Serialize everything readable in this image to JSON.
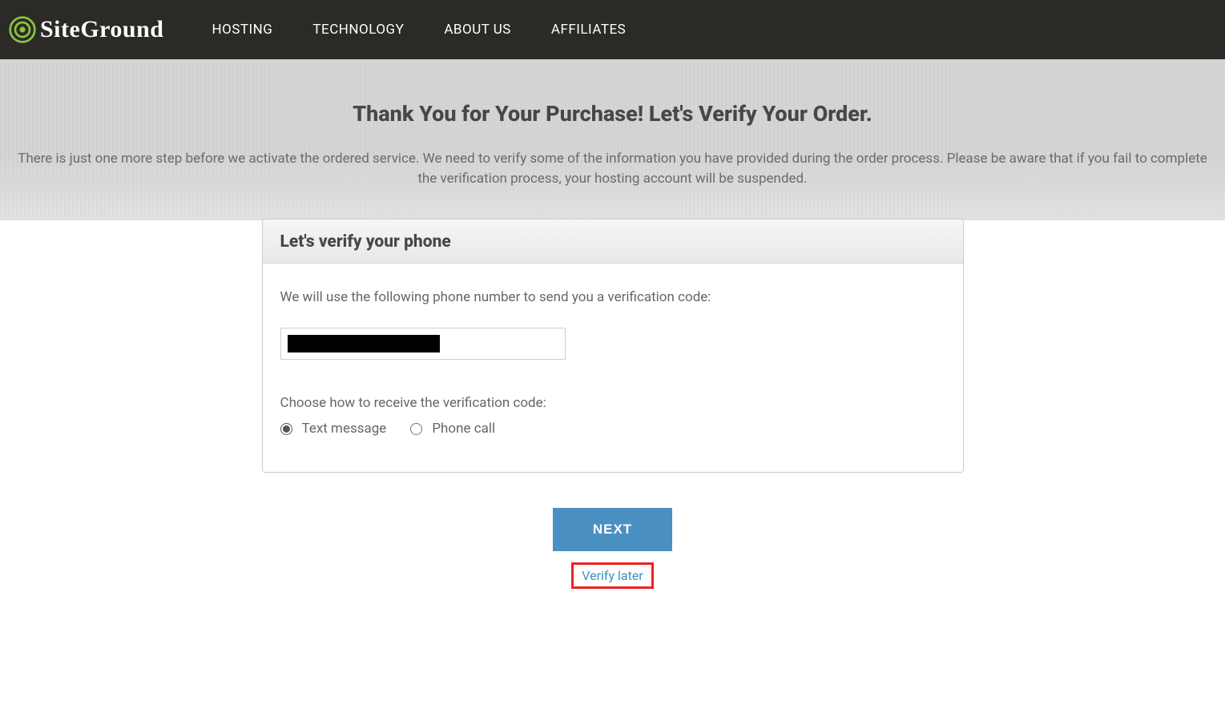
{
  "header": {
    "brand": "SiteGround",
    "nav": {
      "hosting": "HOSTING",
      "technology": "TECHNOLOGY",
      "about": "ABOUT US",
      "affiliates": "AFFILIATES"
    }
  },
  "hero": {
    "title": "Thank You for Your Purchase! Let's Verify Your Order.",
    "subtitle": "There is just one more step before we activate the ordered service. We need to verify some of the information you have provided during the order process. Please be aware that if you fail to complete the verification process, your hosting account will be suspended."
  },
  "card": {
    "title": "Let's verify your phone",
    "lead": "We will use the following phone number to send you a verification code:",
    "phone_value": "",
    "choose_label": "Choose how to receive the verification code:",
    "radio_text": "Text message",
    "radio_call": "Phone call"
  },
  "actions": {
    "next": "NEXT",
    "verify_later": "Verify later"
  }
}
